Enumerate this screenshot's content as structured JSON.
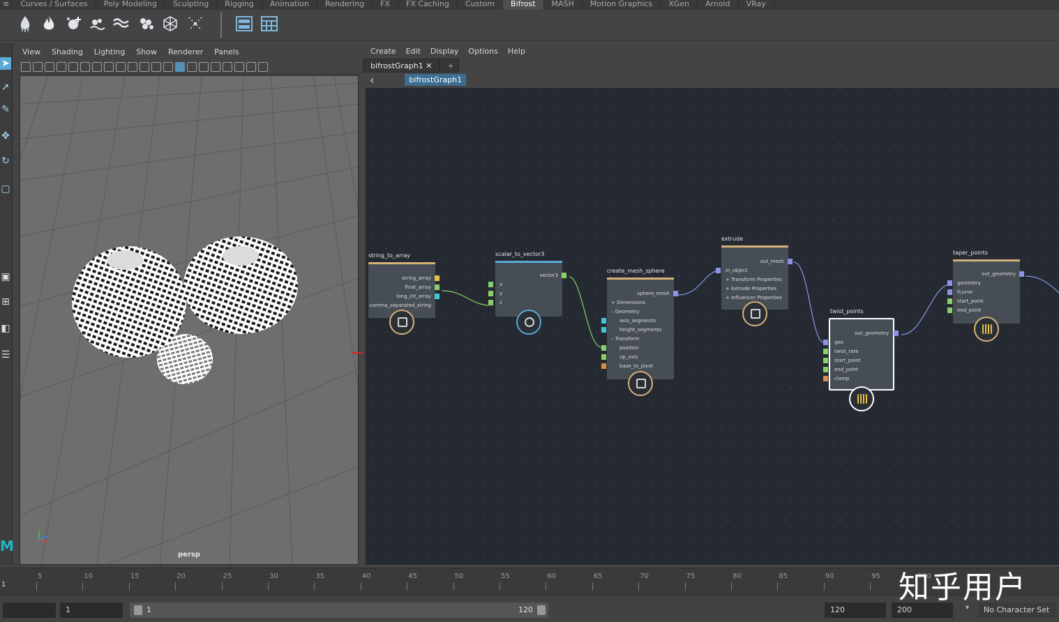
{
  "shelf": {
    "tabs": [
      "Curves / Surfaces",
      "Poly Modeling",
      "Sculpting",
      "Rigging",
      "Animation",
      "Rendering",
      "FX",
      "FX Caching",
      "Custom",
      "Bifrost",
      "MASH",
      "Motion Graphics",
      "XGen",
      "Arnold",
      "VRay"
    ],
    "active_tab": "Bifrost"
  },
  "viewport": {
    "menu": [
      "View",
      "Shading",
      "Lighting",
      "Show",
      "Renderer",
      "Panels"
    ],
    "camera_label": "persp"
  },
  "graph": {
    "menu": [
      "Create",
      "Edit",
      "Display",
      "Options",
      "Help"
    ],
    "tab_label": "bifrostGraph1",
    "tab_add": "+",
    "breadcrumb": "bifrostGraph1",
    "nodes": {
      "string_to_array": {
        "title": "string_to_array",
        "ports": [
          "string_array",
          "float_array",
          "long_int_array",
          "comma_separated_string"
        ]
      },
      "scalar_to_vector3": {
        "title": "scalar_to_vector3",
        "out": "vector3",
        "ports": [
          "x",
          "y",
          "z"
        ]
      },
      "create_mesh_sphere": {
        "title": "create_mesh_sphere",
        "out": "sphere_mesh",
        "ports": [
          "Dimensions",
          "Geometry",
          "axis_segments",
          "height_segments",
          "Transform",
          "position",
          "up_axis",
          "base_to_pivot"
        ]
      },
      "extrude": {
        "title": "extrude",
        "out": "out_mesh",
        "ports": [
          "in_object",
          "Transform Properties",
          "Extrude Properties",
          "Influencer Properties"
        ]
      },
      "twist_points": {
        "title": "twist_points",
        "out": "out_geometry",
        "ports": [
          "geo",
          "twist_rate",
          "start_point",
          "end_point",
          "clamp"
        ]
      },
      "taper_points": {
        "title": "taper_points",
        "out": "out_geometry",
        "ports": [
          "geometry",
          "fcurve",
          "start_point",
          "end_point"
        ]
      }
    }
  },
  "timeline": {
    "ticks": [
      "5",
      "10",
      "15",
      "20",
      "25",
      "30",
      "35",
      "40",
      "45",
      "50",
      "55",
      "60",
      "65",
      "70",
      "75",
      "80",
      "85",
      "90",
      "95",
      "100"
    ],
    "current_frame": "1"
  },
  "range": {
    "start_field": "1",
    "slider_start": "1",
    "slider_end": "120",
    "end_field": "120",
    "anim_end_field": "200",
    "character_set": "No Character Set"
  },
  "watermark": "知乎用户",
  "colors": {
    "accent": "#5aa9d6",
    "graph_bg": "#252a32",
    "node_bg": "#464d55",
    "port_yellow": "#e8c24a",
    "port_green": "#8ad06a",
    "port_cyan": "#3fc8d4",
    "port_blue": "#8a8fe8",
    "port_orange": "#e08a4a",
    "wire_blue": "#8a93e6",
    "wire_green": "#8ad06a",
    "annotation_red": "#e02020"
  }
}
